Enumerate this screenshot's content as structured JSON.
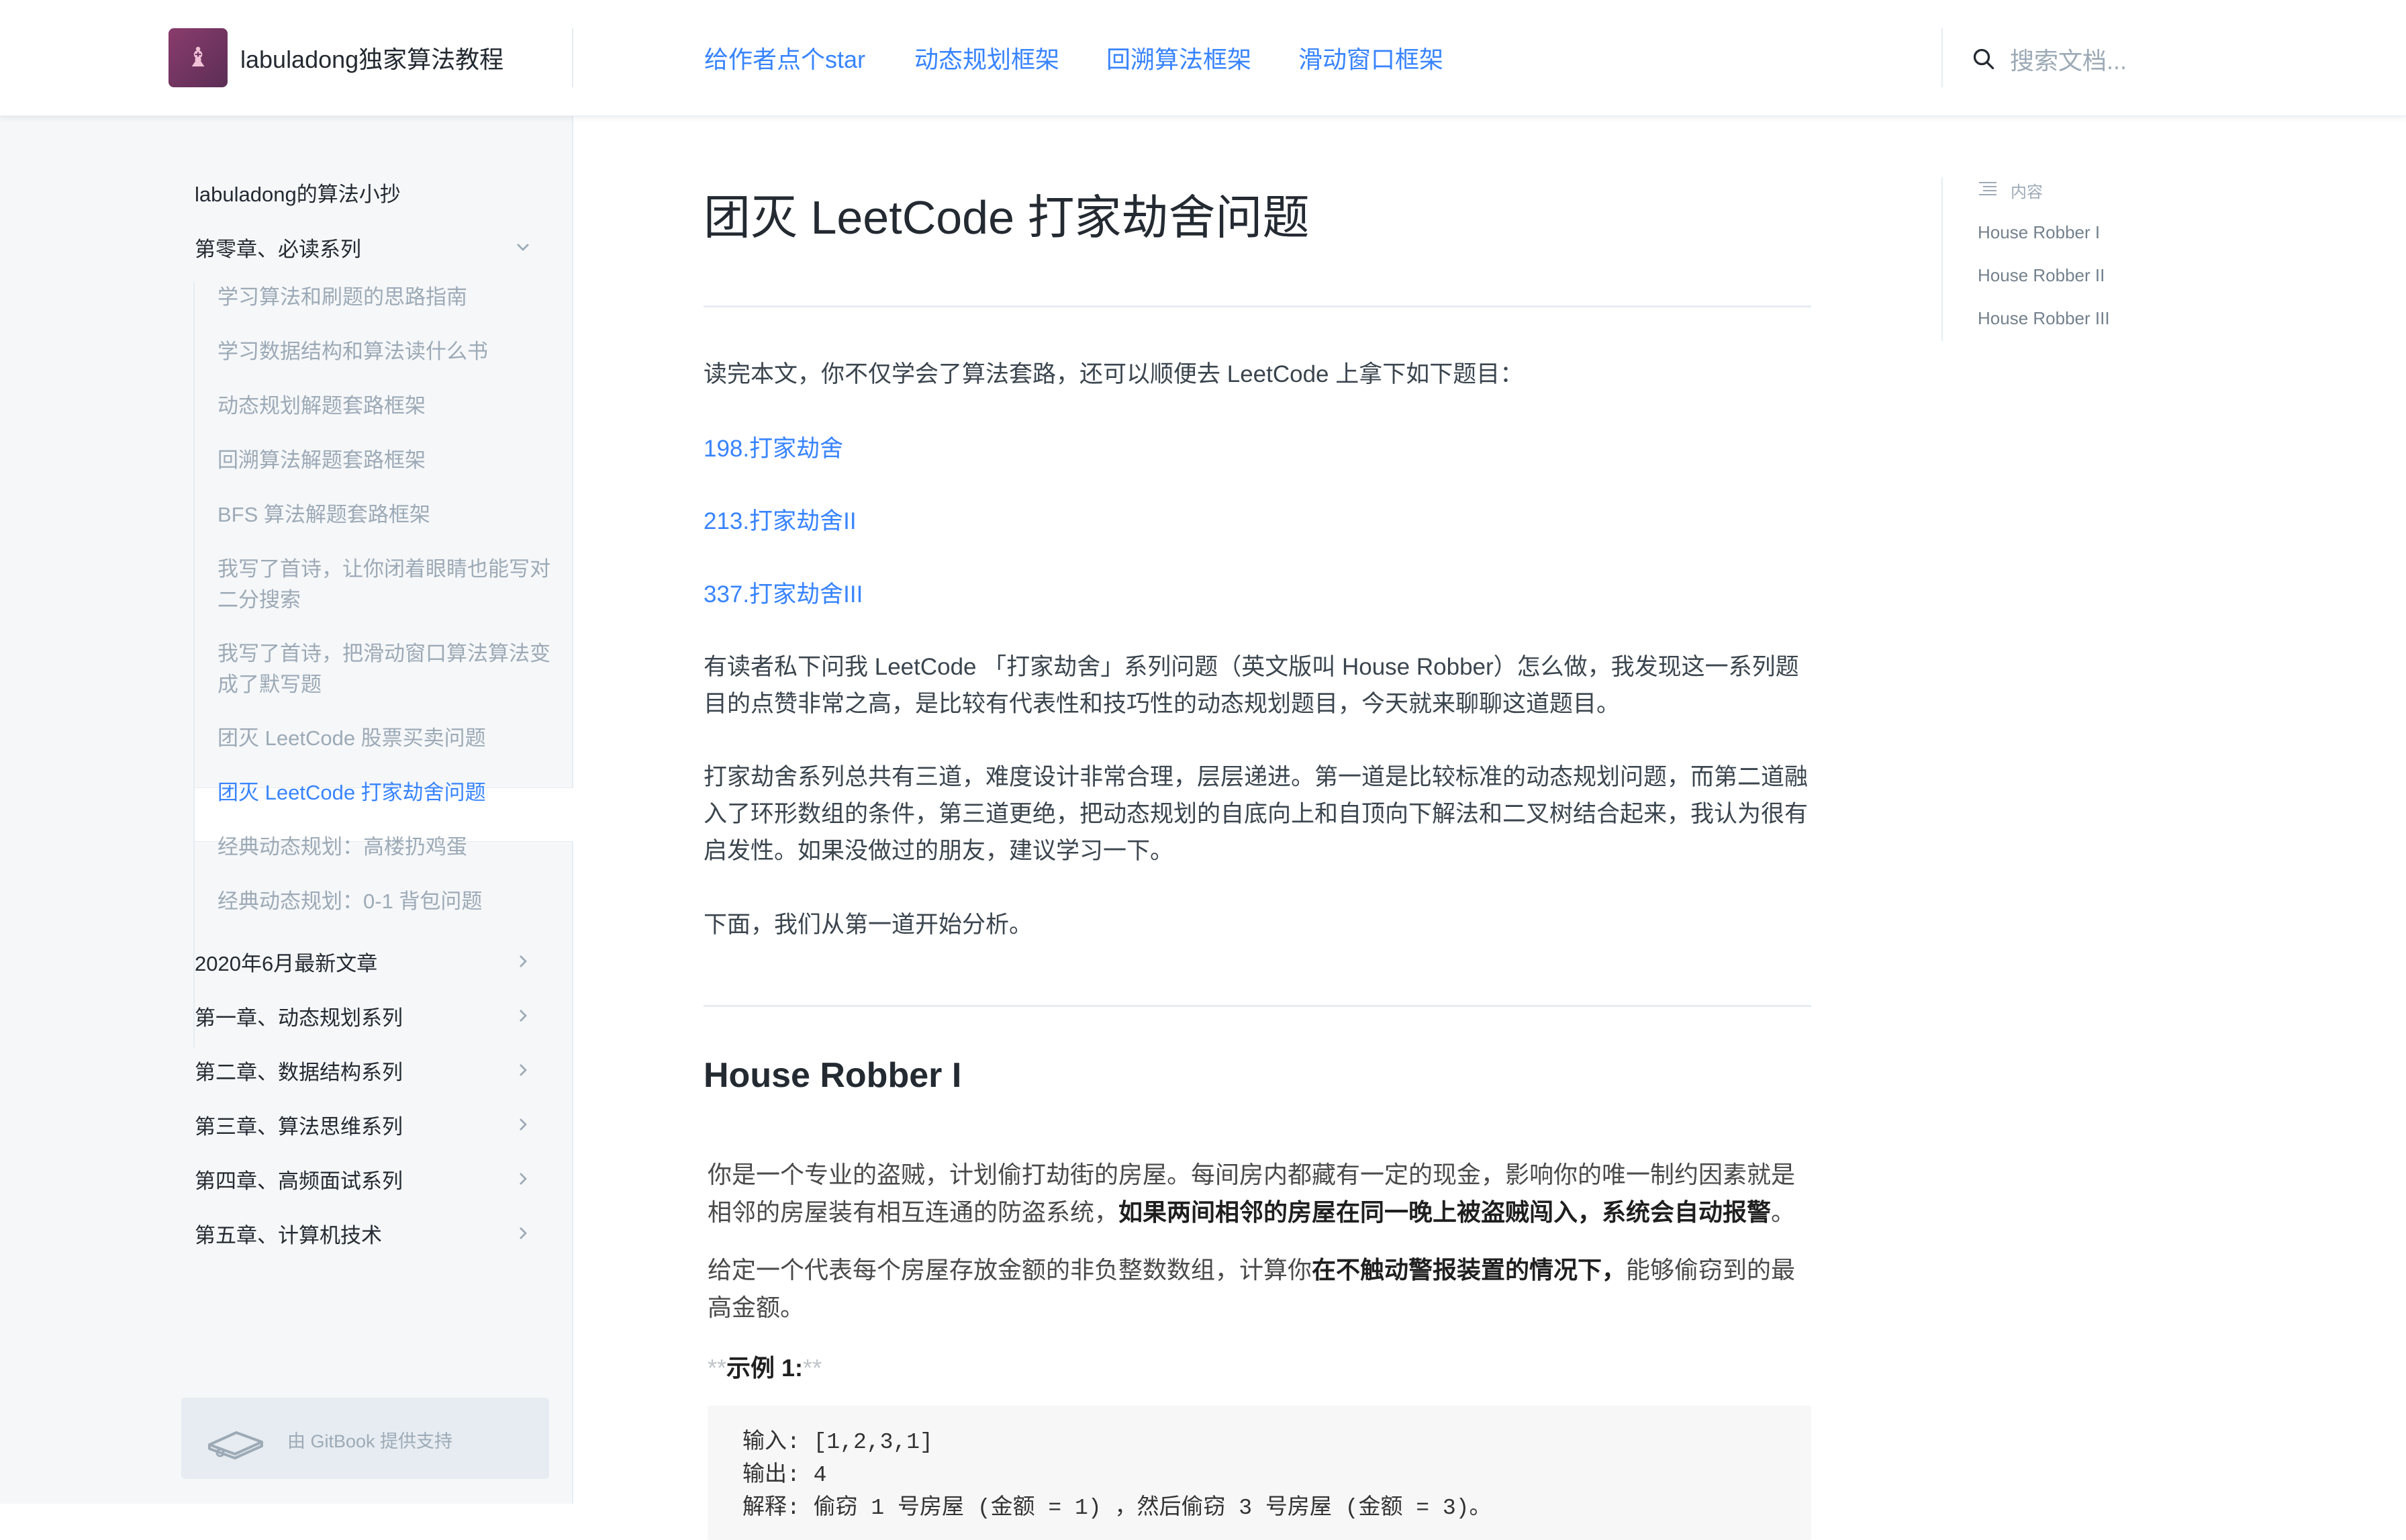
{
  "header": {
    "brand": "labuladong独家算法教程",
    "nav": [
      "给作者点个star",
      "动态规划框架",
      "回溯算法框架",
      "滑动窗口框架"
    ],
    "search_placeholder": "搜索文档..."
  },
  "sidebar": {
    "top_item": "labuladong的算法小抄",
    "chapter0": "第零章、必读系列",
    "chapter0_items": [
      "学习算法和刷题的思路指南",
      "学习数据结构和算法读什么书",
      "动态规划解题套路框架",
      "回溯算法解题套路框架",
      "BFS 算法解题套路框架",
      "我写了首诗，让你闭着眼睛也能写对二分搜索",
      "我写了首诗，把滑动窗口算法算法变成了默写题",
      "团灭 LeetCode 股票买卖问题",
      "团灭 LeetCode 打家劫舍问题",
      "经典动态规划：高楼扔鸡蛋",
      "经典动态规划：0-1 背包问题"
    ],
    "chapters": [
      "2020年6月最新文章",
      "第一章、动态规划系列",
      "第二章、数据结构系列",
      "第三章、算法思维系列",
      "第四章、高频面试系列",
      "第五章、计算机技术"
    ],
    "footer": "由 GitBook 提供支持"
  },
  "main": {
    "title": "团灭 LeetCode 打家劫舍问题",
    "intro": "读完本文，你不仅学会了算法套路，还可以顺便去 LeetCode 上拿下如下题目：",
    "links": [
      "198.打家劫舍",
      "213.打家劫舍II",
      "337.打家劫舍III"
    ],
    "para1": "有读者私下问我 LeetCode 「打家劫舍」系列问题（英文版叫 House Robber）怎么做，我发现这一系列题目的点赞非常之高，是比较有代表性和技巧性的动态规划题目，今天就来聊聊这道题目。",
    "para2": "打家劫舍系列总共有三道，难度设计非常合理，层层递进。第一道是比较标准的动态规划问题，而第二道融入了环形数组的条件，第三道更绝，把动态规划的自底向上和自顶向下解法和二叉树结合起来，我认为很有启发性。如果没做过的朋友，建议学习一下。",
    "para3": "下面，我们从第一道开始分析。",
    "h2": "House Robber I",
    "q1_a": "你是一个专业的盗贼，计划偷打劫街的房屋。每间房内都藏有一定的现金，影响你的唯一制约因素就是相邻的房屋装有相互连通的防盗系统，",
    "q1_b": "如果两间相邻的房屋在同一晚上被盗贼闯入，系统会自动报警",
    "q1_c": "。",
    "q2_a": "给定一个代表每个房屋存放金额的非负整数数组，计算你",
    "q2_b": "在不触动警报装置的情况下，",
    "q2_c": "能够偷窃到的最高金额。",
    "ex_stars": "**",
    "ex_title": "示例 1:",
    "code": [
      "输入: [1,2,3,1]",
      "输出: 4",
      "解释: 偷窃 1 号房屋 (金额 = 1) ，然后偷窃 3 号房屋 (金额 = 3)。"
    ]
  },
  "toc": {
    "heading": "内容",
    "items": [
      "House Robber I",
      "House Robber II",
      "House Robber III"
    ]
  }
}
